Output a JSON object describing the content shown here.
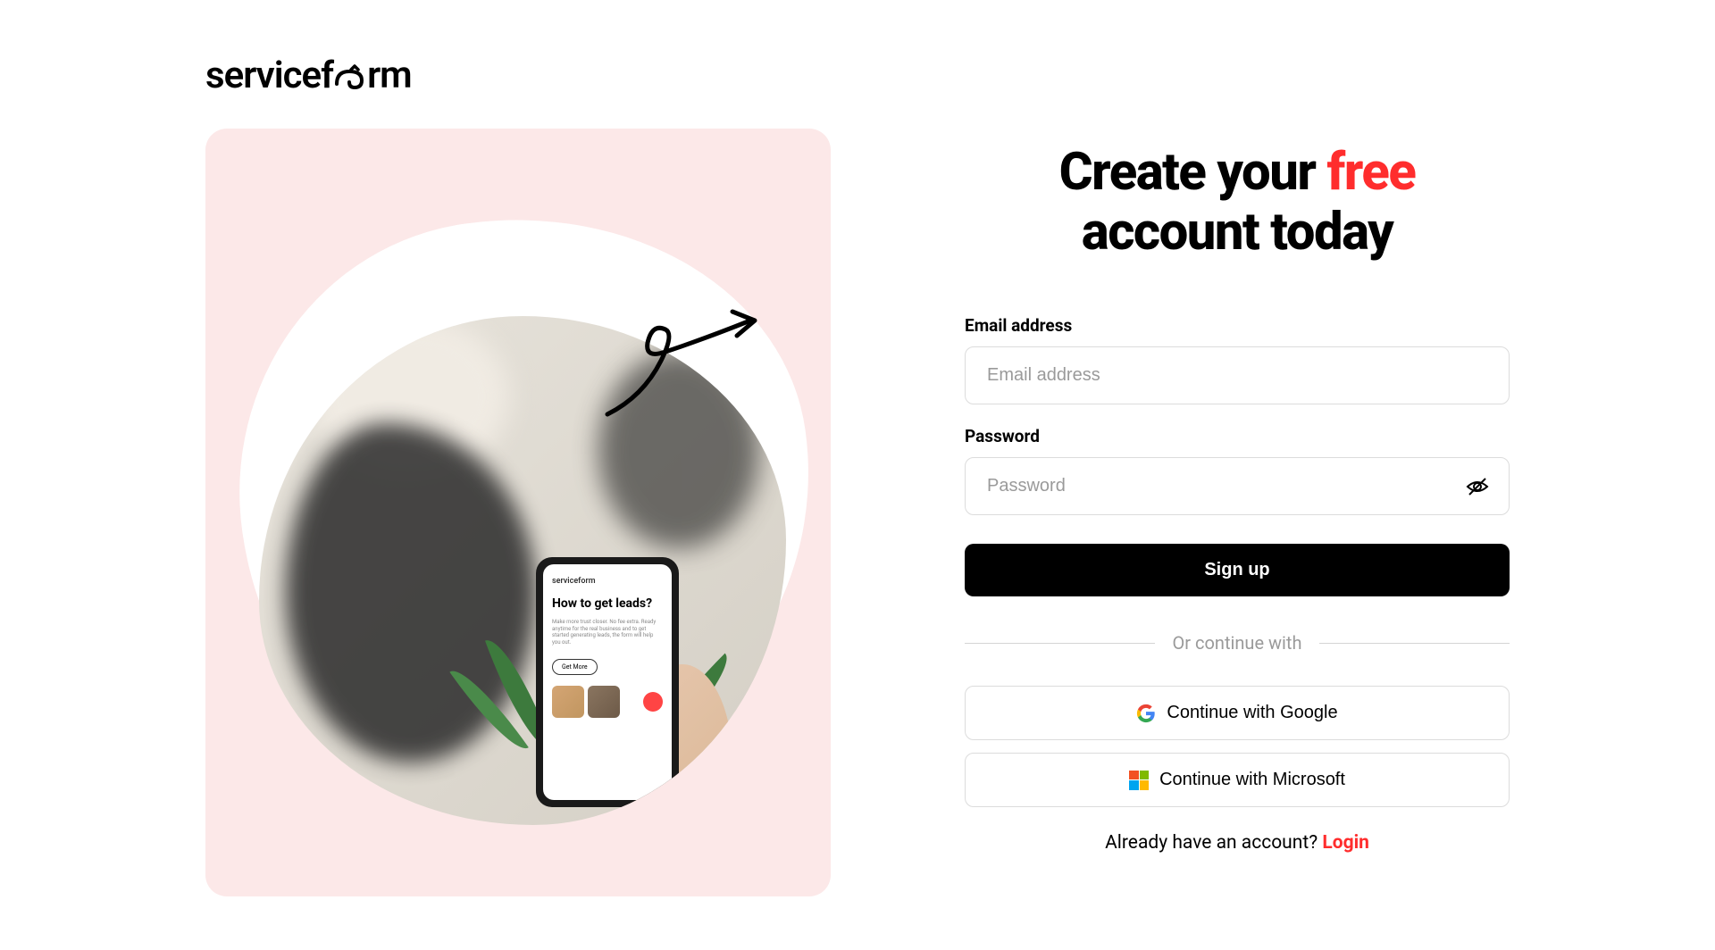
{
  "brand": {
    "name": "serviceform"
  },
  "heading": {
    "part1": "Create your ",
    "accent": "free",
    "part2": " account today"
  },
  "form": {
    "email": {
      "label": "Email address",
      "placeholder": "Email address"
    },
    "password": {
      "label": "Password",
      "placeholder": "Password"
    },
    "submit": "Sign up"
  },
  "divider": "Or continue with",
  "social": {
    "google": "Continue with Google",
    "microsoft": "Continue with Microsoft"
  },
  "login": {
    "prompt": "Already have an account? ",
    "link": "Login"
  },
  "phone": {
    "logo": "serviceform",
    "headline": "How to get leads?",
    "text": "Make more trust closer. No fee extra. Ready anytime for the real business and to get started generating leads, the form will help you out.",
    "button": "Get More"
  }
}
